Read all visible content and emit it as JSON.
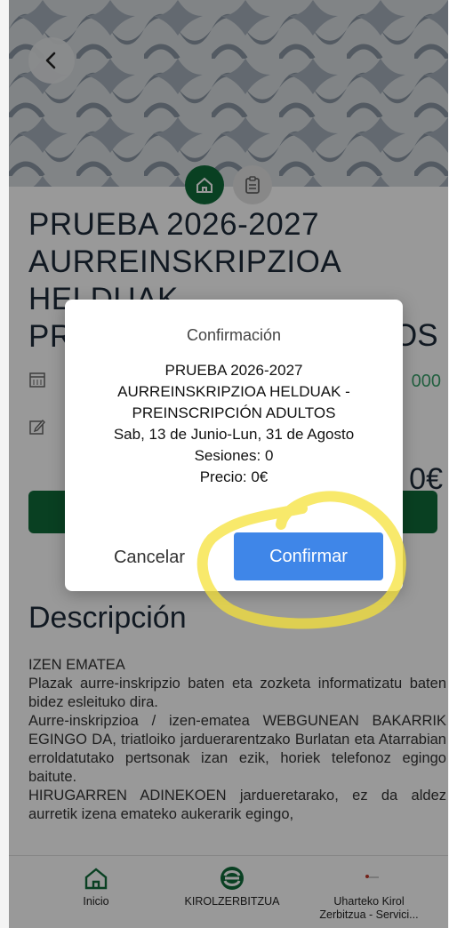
{
  "page": {
    "title_lines": [
      "PRUEBA 2026-2027",
      "AURREINSKRIPZIOA",
      "HELDUAK -",
      "PR"
    ],
    "title_right_fragment": "OS",
    "date_fragment": "000",
    "price_fragment": "0€",
    "tabs": [
      {
        "icon": "home-icon"
      },
      {
        "icon": "clipboard-icon"
      }
    ]
  },
  "description": {
    "heading": "Descripción",
    "paragraphs": [
      "IZEN EMATEA",
      "Plazak aurre-inskripzio baten eta zozketa informatizatu baten bidez esleituko dira.",
      "Aurre-inskripzioa / izen-ematea WEBGUNEAN BAKARRIK EGINGO DA, triatloiko jarduerarentzako Burlatan eta Atarrabian erroldatutako pertsonak izan ezik, horiek telefonoz egingo baitute.",
      "HIRUGARREN ADINEKOEN jardueretarako, ez da aldez aurretik izena emateko aukerarik egingo,"
    ]
  },
  "modal": {
    "title": "Confirmación",
    "lines": [
      "PRUEBA 2026-2027",
      "AURREINSKRIPZIOA HELDUAK -",
      "PREINSCRIPCIÓN ADULTOS",
      "Sab, 13 de Junio-Lun, 31 de Agosto",
      "Sesiones: 0",
      "Precio: 0€"
    ],
    "cancel_label": "Cancelar",
    "confirm_label": "Confirmar"
  },
  "bottom_nav": [
    {
      "label": "Inicio",
      "icon": "home-icon"
    },
    {
      "label": "KIROLZERBITZUA",
      "icon": "kirolzerbitzua-logo-icon"
    },
    {
      "label": "Uharteko Kirol Zerbitzua - Servici...",
      "icon": "small-logo-icon"
    }
  ],
  "colors": {
    "accent_green": "#0f6b3a",
    "confirm_blue": "#3f86e8",
    "highlight_yellow": "#f6e23a"
  }
}
